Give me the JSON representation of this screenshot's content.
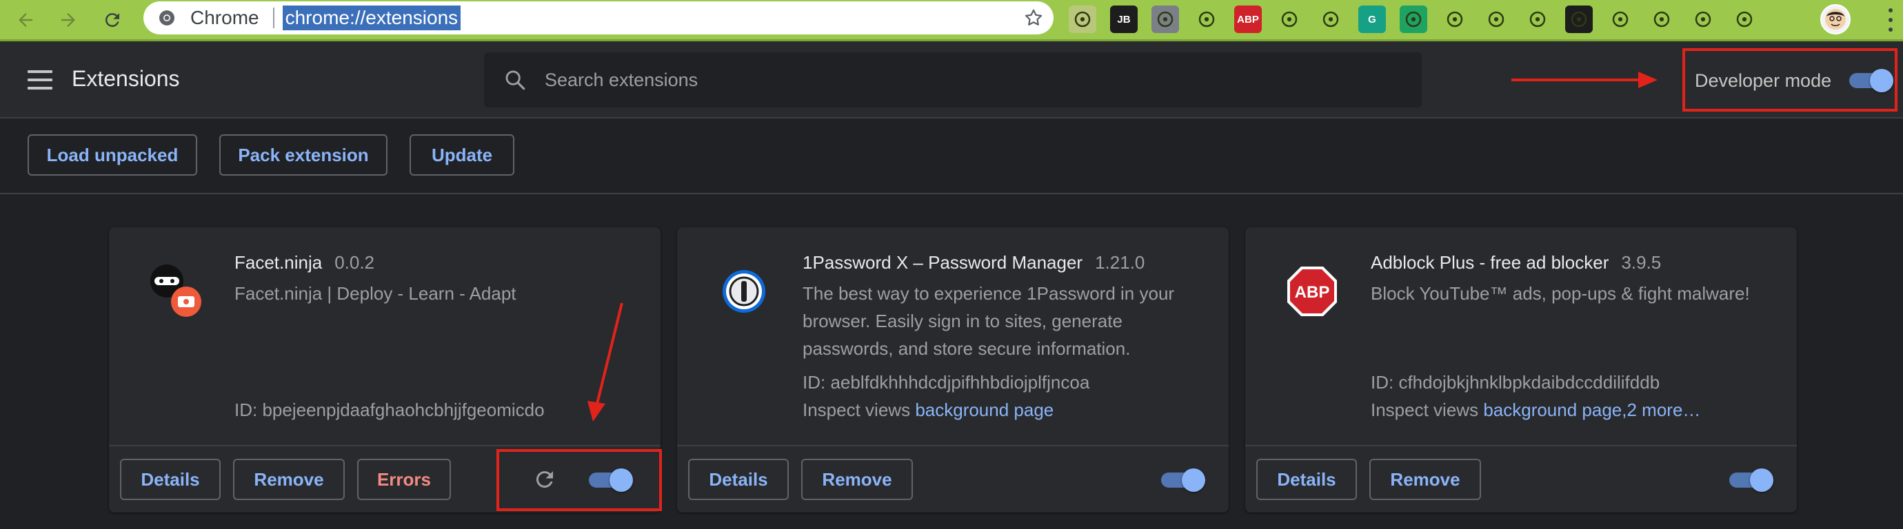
{
  "browser": {
    "app_name": "Chrome",
    "url": "chrome://extensions",
    "toolbar_icons": [
      {
        "name": "extension-icon-1",
        "text": "",
        "bg": "#b9c77a"
      },
      {
        "name": "jetbrains-icon",
        "text": "JB",
        "bg": "#1d1d1d"
      },
      {
        "name": "chart-extension-icon",
        "text": "",
        "bg": "#7b7f88"
      },
      {
        "name": "react-devtools-icon",
        "text": "",
        "bg": "transparent"
      },
      {
        "name": "adblock-plus-icon",
        "text": "ABP",
        "bg": "#d0222a"
      },
      {
        "name": "target-extension-icon",
        "text": "",
        "bg": "transparent"
      },
      {
        "name": "lighthouse-icon",
        "text": "",
        "bg": "transparent"
      },
      {
        "name": "grammarly-icon",
        "text": "G",
        "bg": "#16a085"
      },
      {
        "name": "speech-bubble-icon",
        "text": "",
        "bg": "#1ea362"
      },
      {
        "name": "eyedropper-icon",
        "text": "",
        "bg": "transparent"
      },
      {
        "name": "color-picker-icon",
        "text": "",
        "bg": "transparent"
      },
      {
        "name": "ux-tools-icon",
        "text": "",
        "bg": "transparent"
      },
      {
        "name": "github-icon",
        "text": "",
        "bg": "#1d1d1d"
      },
      {
        "name": "key-extension-icon",
        "text": "",
        "bg": "transparent"
      },
      {
        "name": "onepassword-toolbar-icon",
        "text": "",
        "bg": "transparent"
      },
      {
        "name": "puzzle-group-icon",
        "text": "",
        "bg": "transparent"
      },
      {
        "name": "extensions-puzzle-icon",
        "text": "",
        "bg": "transparent"
      }
    ]
  },
  "header": {
    "title": "Extensions",
    "search_placeholder": "Search extensions",
    "developer_mode_label": "Developer mode",
    "developer_mode_on": true
  },
  "toolbar": {
    "load_unpacked": "Load unpacked",
    "pack_extension": "Pack extension",
    "update": "Update"
  },
  "extensions": [
    {
      "name": "Facet.ninja",
      "version": "0.0.2",
      "description": "Facet.ninja | Deploy - Learn - Adapt",
      "id_text": "ID: bpejeenpjdaafghaohcbhjjfgeomicdo",
      "details_label": "Details",
      "remove_label": "Remove",
      "errors_label": "Errors",
      "enabled": true
    },
    {
      "name": "1Password X – Password Manager",
      "version": "1.21.0",
      "description": "The best way to experience 1Password in your browser. Easily sign in to sites, generate passwords, and store secure information.",
      "id_text": "ID: aeblfdkhhhdcdjpifhhbdiojplfjncoa",
      "inspect_label": "Inspect views",
      "inspect_link": "background page",
      "details_label": "Details",
      "remove_label": "Remove",
      "enabled": true
    },
    {
      "name": "Adblock Plus - free ad blocker",
      "version": "3.9.5",
      "description": "Block YouTube™ ads, pop-ups & fight malware!",
      "id_text": "ID: cfhdojbkjhnklbpkdaibdccddilifddb",
      "inspect_label": "Inspect views",
      "inspect_link": "background page,2 more…",
      "details_label": "Details",
      "remove_label": "Remove",
      "enabled": true
    }
  ],
  "colors": {
    "annotation_red": "#e2231a",
    "accent_blue": "#8ab4f8",
    "error_red": "#f28b82",
    "browser_green": "#9cc94c"
  }
}
